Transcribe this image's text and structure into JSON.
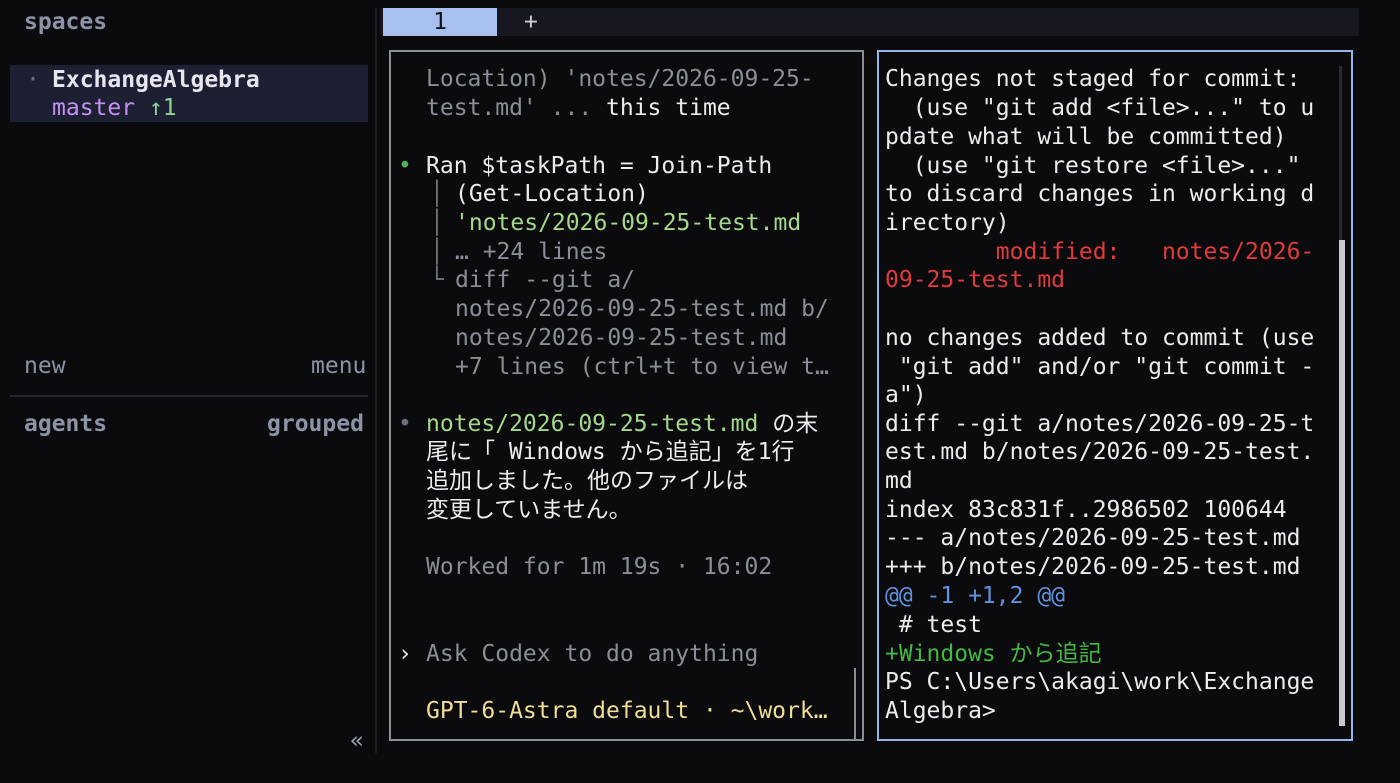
{
  "sidebar": {
    "spaces_label": "spaces",
    "space": {
      "bullet": "·",
      "name": "ExchangeAlgebra",
      "branch": "master",
      "ahead": "↑1"
    },
    "new_label": "new",
    "menu_label": "menu",
    "agents_label": "agents",
    "grouped_label": "grouped",
    "collapse_glyph": "«"
  },
  "tabs": {
    "active": "1",
    "add": "+"
  },
  "left_pane": {
    "l1": "Location) 'notes/2026-09-25-",
    "l2a": "test.md' ... ",
    "l2b": "this time",
    "bullet": "•",
    "l3": "Ran $taskPath = Join-Path",
    "tree_bar": "│",
    "tree_end": "└",
    "l4": "(Get-Location)",
    "l5": "'notes/2026-09-25-test.md",
    "l6": "… +24 lines",
    "l7": "diff --git a/",
    "l8": "notes/2026-09-25-test.md b/",
    "l9": "notes/2026-09-25-test.md",
    "l10": "+7 lines (ctrl+t to view t…",
    "l11a": "notes/2026-09-25-test.md",
    "l11b": " の末",
    "l12": "尾に「 Windows から追記」を1行",
    "l13": "追加しました。他のファイルは",
    "l14": "変更していません。",
    "worked": "Worked for 1m 19s · 16:02",
    "prompt_glyph": "›",
    "prompt_placeholder": "Ask Codex to do anything",
    "model_line": "GPT-6-Astra default · ~\\work…"
  },
  "right_pane": {
    "r1": "Changes not staged for commit:",
    "r2": "  (use \"git add <file>...\" to u",
    "r3": "pdate what will be committed)",
    "r4": "  (use \"git restore <file>...\"",
    "r5": "to discard changes in working d",
    "r6": "irectory)",
    "r7": "        modified:   notes/2026-",
    "r8": "09-25-test.md",
    "r9": "no changes added to commit (use",
    "r10": " \"git add\" and/or \"git commit -",
    "r11": "a\")",
    "r12": "diff --git a/notes/2026-09-25-t",
    "r13": "est.md b/notes/2026-09-25-test.",
    "r14": "md",
    "r15": "index 83c831f..2986502 100644",
    "r16": "--- a/notes/2026-09-25-test.md",
    "r17": "+++ b/notes/2026-09-25-test.md",
    "r18": "@@ -1 +1,2 @@",
    "r19": " # test",
    "r20": "+Windows から追記",
    "r21": "PS C:\\Users\\akagi\\work\\Exchange",
    "r22": "Algebra>"
  },
  "colors": {
    "background": "#0b0b0e",
    "active_tab": "#a7c0ee",
    "focused_pane_border": "#93b6ea",
    "modified_red": "#df3b3b",
    "diff_add_green": "#43b843",
    "hunk_blue": "#5f93df"
  }
}
